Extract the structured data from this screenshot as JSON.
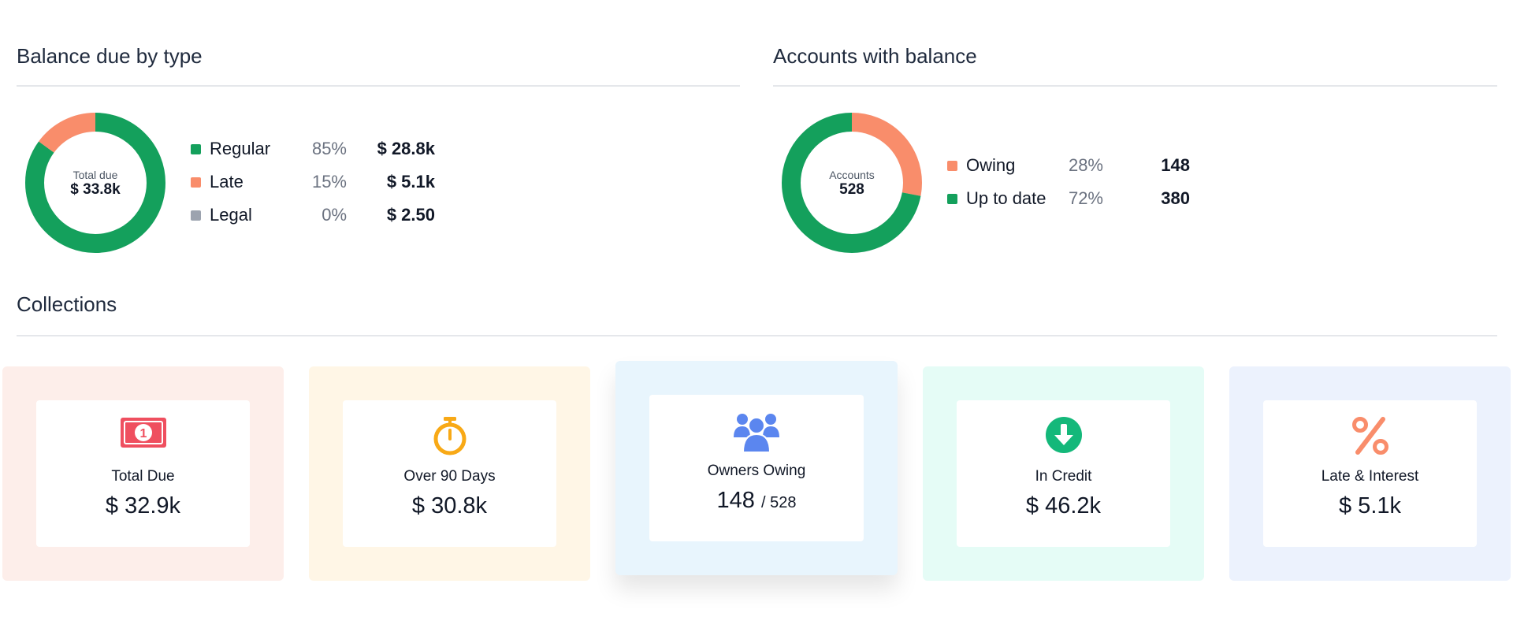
{
  "balance_due": {
    "title": "Balance due by type",
    "center_label": "Total due",
    "center_value": "$ 33.8k",
    "items": [
      {
        "name": "Regular",
        "pct": "85%",
        "amount": "$ 28.8k",
        "color": "#14a05c",
        "share": 0.85
      },
      {
        "name": "Late",
        "pct": "15%",
        "amount": "$ 5.1k",
        "color": "#f98d6b",
        "share": 0.15
      },
      {
        "name": "Legal",
        "pct": "0%",
        "amount": "$ 2.50",
        "color": "#9ca3af",
        "share": 0.0
      }
    ]
  },
  "accounts": {
    "title": "Accounts with balance",
    "center_label": "Accounts",
    "center_value": "528",
    "items": [
      {
        "name": "Owing",
        "pct": "28%",
        "amount": "148",
        "color": "#f98d6b",
        "share": 0.28
      },
      {
        "name": "Up to date",
        "pct": "72%",
        "amount": "380",
        "color": "#14a05c",
        "share": 0.72
      }
    ]
  },
  "collections": {
    "title": "Collections",
    "cards": [
      {
        "label": "Total Due",
        "value": "$ 32.9k",
        "sub": "",
        "icon": "money-bill-icon",
        "bg": "#fdeeea",
        "icon_color": "#ef4f5f"
      },
      {
        "label": "Over 90 Days",
        "value": "$ 30.8k",
        "sub": "",
        "icon": "stopwatch-icon",
        "bg": "#fff6e6",
        "icon_color": "#f8a916"
      },
      {
        "label": "Owners Owing",
        "value": "148",
        "sub": "/ 528",
        "icon": "users-icon",
        "bg": "#e8f5fd",
        "icon_color": "#5b86ef"
      },
      {
        "label": "In Credit",
        "value": "$ 46.2k",
        "sub": "",
        "icon": "arrow-down-circle-icon",
        "bg": "#e5fcf6",
        "icon_color": "#14b87a"
      },
      {
        "label": "Late & Interest",
        "value": "$ 5.1k",
        "sub": "",
        "icon": "percent-icon",
        "bg": "#ecf2fd",
        "icon_color": "#f98d6b"
      }
    ]
  }
}
